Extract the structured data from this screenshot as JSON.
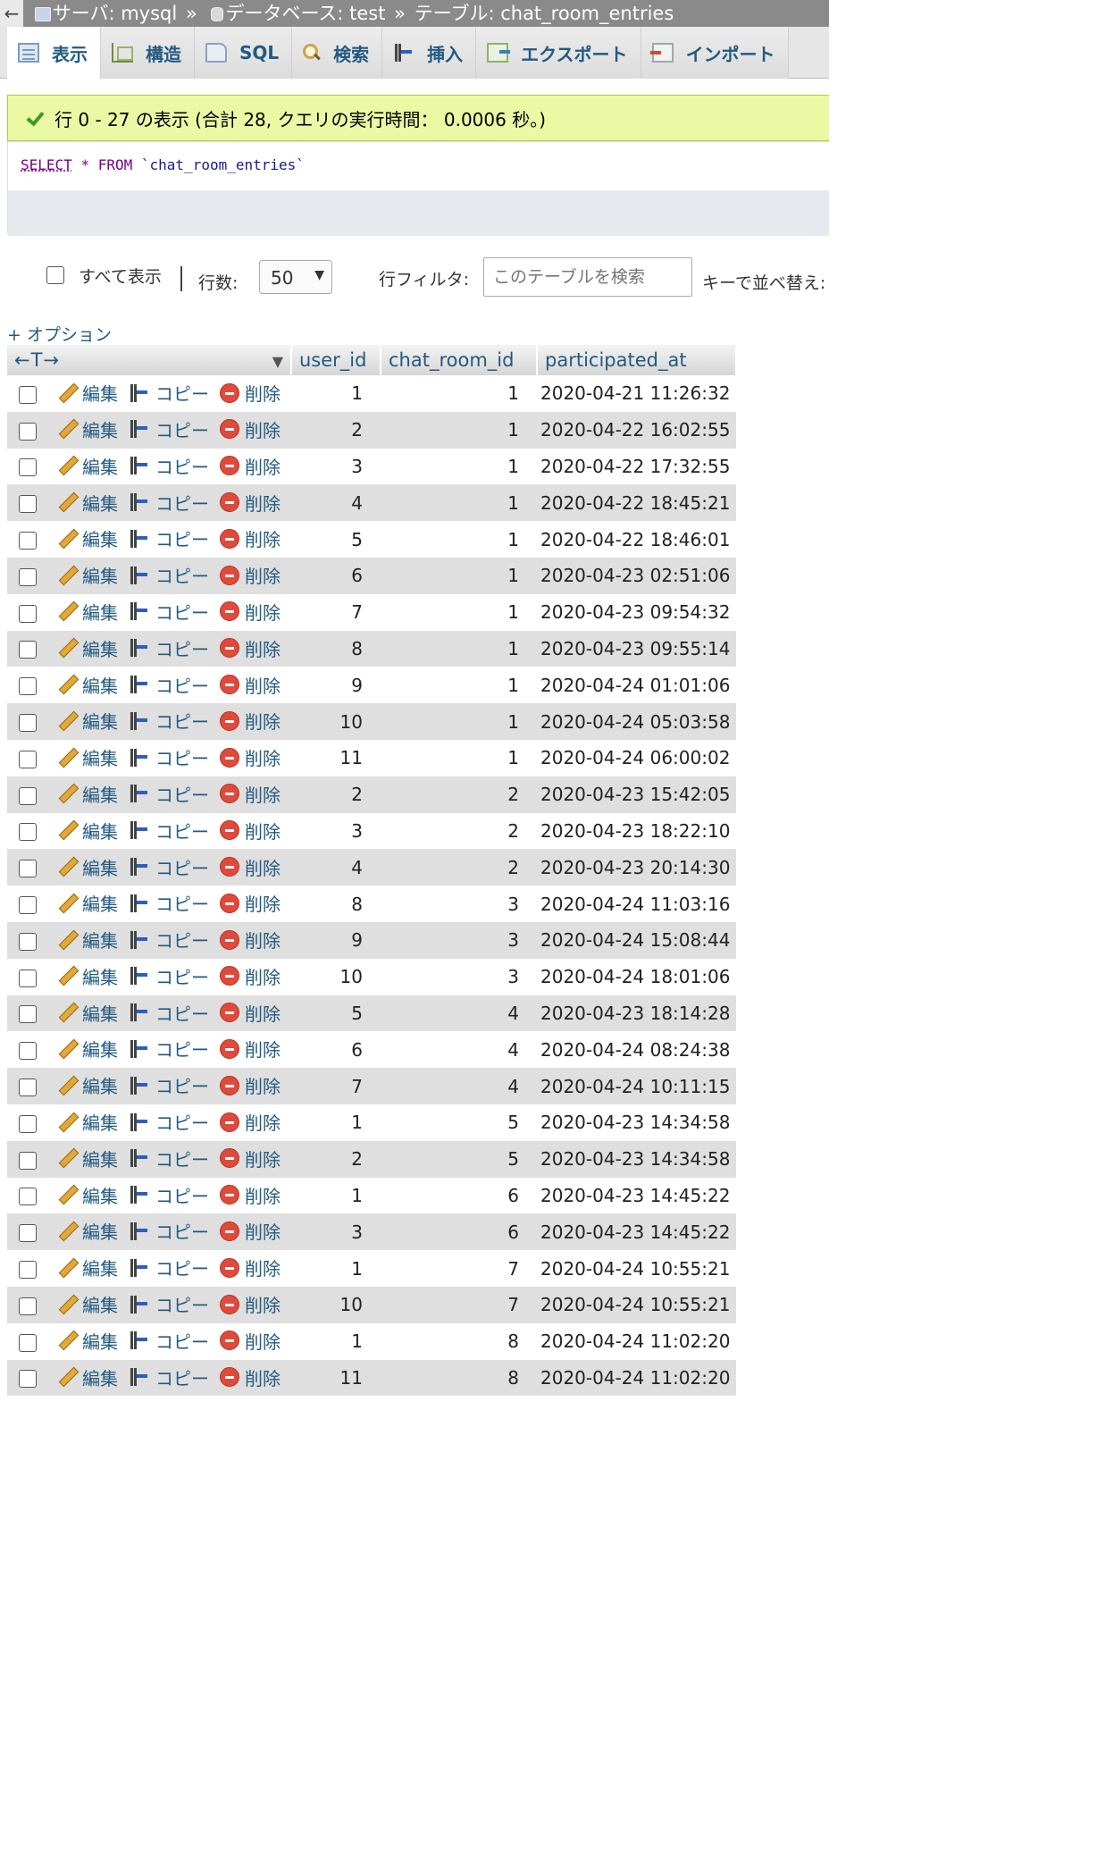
{
  "breadcrumb": {
    "back": "←",
    "server": "サーバ: mysql",
    "database": "データベース: test",
    "table": "テーブル: chat_room_entries",
    "sep": "»"
  },
  "tabs": [
    {
      "label": "表示",
      "icon": "browse-icon",
      "active": true
    },
    {
      "label": "構造",
      "icon": "structure-icon"
    },
    {
      "label": "SQL",
      "icon": "sql-icon"
    },
    {
      "label": "検索",
      "icon": "search-icon"
    },
    {
      "label": "挿入",
      "icon": "insert-icon"
    },
    {
      "label": "エクスポート",
      "icon": "export-icon"
    },
    {
      "label": "インポート",
      "icon": "import-icon"
    }
  ],
  "message": "行 0 - 27 の表示 (合計 28, クエリの実行時間： 0.0006 秒。)",
  "query": {
    "select": "SELECT",
    "star": "*",
    "from": "FROM",
    "table": "`chat_room_entries`"
  },
  "nav": {
    "show_all": "すべて表示",
    "rows_label": "行数:",
    "rows_value": "50",
    "filter_label": "行フィルタ:",
    "filter_placeholder": "このテーブルを検索",
    "sort_label": "キーで並べ替え:"
  },
  "options_link": "+ オプション",
  "columns": {
    "arrows": "←T→",
    "user_id": "user_id",
    "chat_room_id": "chat_room_id",
    "participated_at": "participated_at"
  },
  "actions": {
    "edit": "編集",
    "copy": "コピー",
    "delete": "削除"
  },
  "rows": [
    {
      "user_id": "1",
      "chat_room_id": "1",
      "participated_at": "2020-04-21 11:26:32"
    },
    {
      "user_id": "2",
      "chat_room_id": "1",
      "participated_at": "2020-04-22 16:02:55"
    },
    {
      "user_id": "3",
      "chat_room_id": "1",
      "participated_at": "2020-04-22 17:32:55"
    },
    {
      "user_id": "4",
      "chat_room_id": "1",
      "participated_at": "2020-04-22 18:45:21"
    },
    {
      "user_id": "5",
      "chat_room_id": "1",
      "participated_at": "2020-04-22 18:46:01"
    },
    {
      "user_id": "6",
      "chat_room_id": "1",
      "participated_at": "2020-04-23 02:51:06"
    },
    {
      "user_id": "7",
      "chat_room_id": "1",
      "participated_at": "2020-04-23 09:54:32"
    },
    {
      "user_id": "8",
      "chat_room_id": "1",
      "participated_at": "2020-04-23 09:55:14"
    },
    {
      "user_id": "9",
      "chat_room_id": "1",
      "participated_at": "2020-04-24 01:01:06"
    },
    {
      "user_id": "10",
      "chat_room_id": "1",
      "participated_at": "2020-04-24 05:03:58"
    },
    {
      "user_id": "11",
      "chat_room_id": "1",
      "participated_at": "2020-04-24 06:00:02"
    },
    {
      "user_id": "2",
      "chat_room_id": "2",
      "participated_at": "2020-04-23 15:42:05"
    },
    {
      "user_id": "3",
      "chat_room_id": "2",
      "participated_at": "2020-04-23 18:22:10"
    },
    {
      "user_id": "4",
      "chat_room_id": "2",
      "participated_at": "2020-04-23 20:14:30"
    },
    {
      "user_id": "8",
      "chat_room_id": "3",
      "participated_at": "2020-04-24 11:03:16"
    },
    {
      "user_id": "9",
      "chat_room_id": "3",
      "participated_at": "2020-04-24 15:08:44"
    },
    {
      "user_id": "10",
      "chat_room_id": "3",
      "participated_at": "2020-04-24 18:01:06"
    },
    {
      "user_id": "5",
      "chat_room_id": "4",
      "participated_at": "2020-04-23 18:14:28"
    },
    {
      "user_id": "6",
      "chat_room_id": "4",
      "participated_at": "2020-04-24 08:24:38"
    },
    {
      "user_id": "7",
      "chat_room_id": "4",
      "participated_at": "2020-04-24 10:11:15"
    },
    {
      "user_id": "1",
      "chat_room_id": "5",
      "participated_at": "2020-04-23 14:34:58"
    },
    {
      "user_id": "2",
      "chat_room_id": "5",
      "participated_at": "2020-04-23 14:34:58"
    },
    {
      "user_id": "1",
      "chat_room_id": "6",
      "participated_at": "2020-04-23 14:45:22"
    },
    {
      "user_id": "3",
      "chat_room_id": "6",
      "participated_at": "2020-04-23 14:45:22"
    },
    {
      "user_id": "1",
      "chat_room_id": "7",
      "participated_at": "2020-04-24 10:55:21"
    },
    {
      "user_id": "10",
      "chat_room_id": "7",
      "participated_at": "2020-04-24 10:55:21"
    },
    {
      "user_id": "1",
      "chat_room_id": "8",
      "participated_at": "2020-04-24 11:02:20"
    },
    {
      "user_id": "11",
      "chat_room_id": "8",
      "participated_at": "2020-04-24 11:02:20"
    }
  ]
}
